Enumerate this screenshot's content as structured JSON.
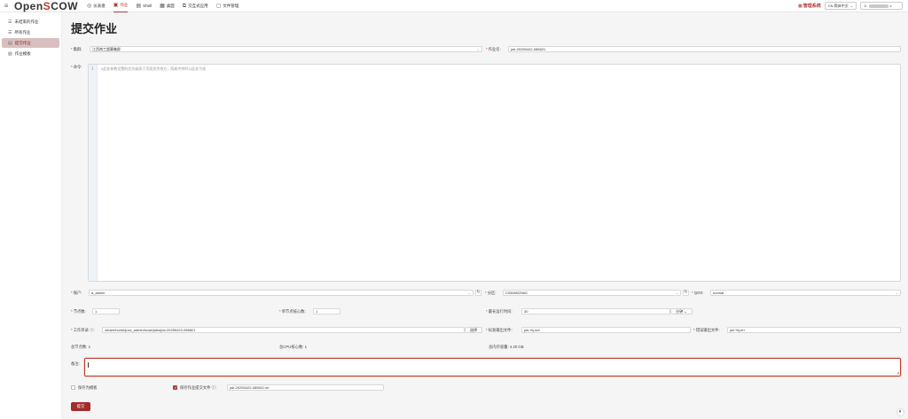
{
  "header": {
    "logo_prefix": "Open",
    "logo_s": "S",
    "logo_suffix": "COW",
    "nav": [
      {
        "label": "仪表盘",
        "icon": "dashboard-icon"
      },
      {
        "label": "作业",
        "icon": "job-icon",
        "active": true
      },
      {
        "label": "Shell",
        "icon": "terminal-icon"
      },
      {
        "label": "桌面",
        "icon": "desktop-icon"
      },
      {
        "label": "交互式应用",
        "icon": "app-icon"
      },
      {
        "label": "文件管理",
        "icon": "file-icon"
      }
    ],
    "mgmt_label": "管理系统",
    "lang_label": "CN 简体中文",
    "user_suffix": "v"
  },
  "sidebar": {
    "items": [
      {
        "label": "未结束的作业",
        "icon": "list-icon"
      },
      {
        "label": "所有作业",
        "icon": "list-icon"
      },
      {
        "label": "提交作业",
        "icon": "submit-icon",
        "active": true
      },
      {
        "label": "作业模板",
        "icon": "template-icon"
      }
    ]
  },
  "form": {
    "title": "提交作业",
    "cluster_label": "集群:",
    "cluster_value": "江西南工超算集群",
    "job_name_label": "作业名:",
    "job_name_value": "job-20250422-085821",
    "command_label": "命令:",
    "command_line_no": "1",
    "command_placeholder": "#此处参数设置的优先级高于页面其余地方，两者冲突时以此处为准",
    "account_label": "账户:",
    "account_value": "a_admin",
    "partition_label": "分区:",
    "partition_value": "C056M0256G",
    "qos_label": "QOS:",
    "qos_value": "normal",
    "nodes_label": "节点数:",
    "nodes_value": "1",
    "cores_label": "单节点核心数:",
    "cores_value": "1",
    "maxtime_label": "最长运行时间:",
    "maxtime_value": "30",
    "maxtime_unit": "分钟",
    "workdir_label": "工作目录 ⓘ:",
    "workdir_value": "/share/home/juzz_admin/scow/jobs/job-20250422-085821",
    "workdir_select": "选择",
    "stdout_label": "标准输出文件:",
    "stdout_value": "job.%j.out",
    "stderr_label": "错误输出文件:",
    "stderr_value": "job.%j.err",
    "total_nodes": "总节点数: 1",
    "total_cpu": "总CPU核心数: 1",
    "total_mem": "总内存容量: 4.20 GB",
    "remark_label": "备注:",
    "save_template_label": "保存为模板",
    "save_script_label": "保存作业提交文件 ⓘ:",
    "save_script_value": "job-20250422-085821.sh",
    "submit_label": "提交"
  }
}
